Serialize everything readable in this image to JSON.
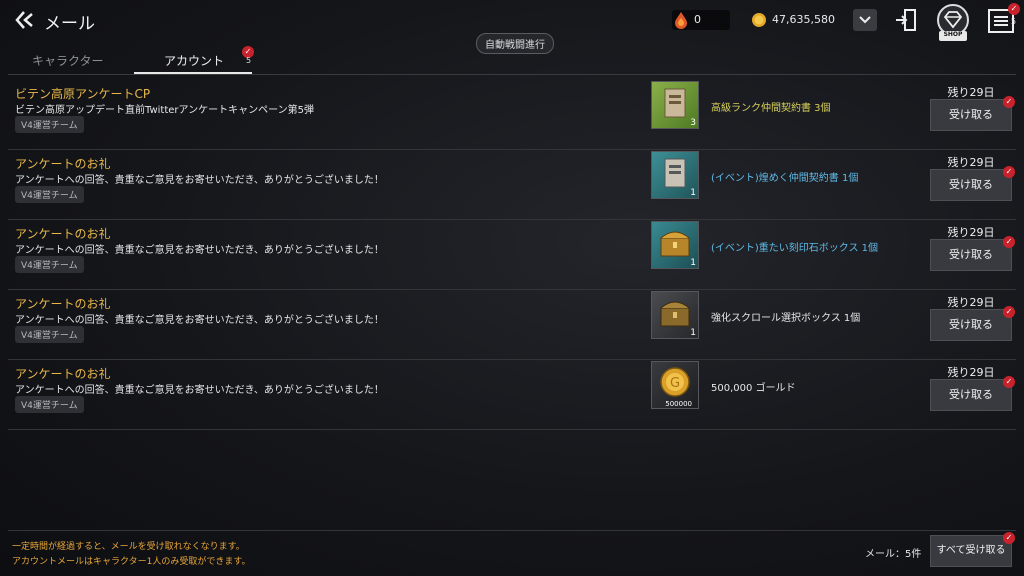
{
  "header": {
    "title": "メール",
    "auto_battle": "自動戦闘進行",
    "ruby_amount": "0",
    "gold_amount": "47,635,580",
    "shop_label": "SHOP",
    "menu_badge": "5"
  },
  "tabs": [
    {
      "label": "キャラクター"
    },
    {
      "label": "アカウント",
      "badge": "5"
    }
  ],
  "mails": [
    {
      "title": "ビテン高原アンケートCP",
      "body": "ビテン高原アップデート直前Twitterアンケートキャンペーン第5弾",
      "sender": "V4運営チーム",
      "item_name": "高級ランク仲間契約書 3個",
      "item_qty": "3",
      "item_color": "#d6cf5a",
      "remaining": "残り29日",
      "button": "受け取る"
    },
    {
      "title": "アンケートのお礼",
      "body": "アンケートへの回答、貴重なご意見をお寄せいただき、ありがとうございました！",
      "sender": "V4運営チーム",
      "item_name": "(イベント)煌めく仲間契約書 1個",
      "item_qty": "1",
      "item_color": "#5fb9e6",
      "remaining": "残り29日",
      "button": "受け取る"
    },
    {
      "title": "アンケートのお礼",
      "body": "アンケートへの回答、貴重なご意見をお寄せいただき、ありがとうございました！",
      "sender": "V4運営チーム",
      "item_name": "(イベント)重たい刻印石ボックス 1個",
      "item_qty": "1",
      "item_color": "#5fb9e6",
      "remaining": "残り29日",
      "button": "受け取る"
    },
    {
      "title": "アンケートのお礼",
      "body": "アンケートへの回答、貴重なご意見をお寄せいただき、ありがとうございました！",
      "sender": "V4運営チーム",
      "item_name": "強化スクロール選択ボックス 1個",
      "item_qty": "1",
      "item_color": "#e6e6e6",
      "remaining": "残り29日",
      "button": "受け取る"
    },
    {
      "title": "アンケートのお礼",
      "body": "アンケートへの回答、貴重なご意見をお寄せいただき、ありがとうございました！",
      "sender": "V4運営チーム",
      "item_name": "500,000 ゴールド",
      "item_qty": "500000",
      "item_color": "#e6e6e6",
      "remaining": "残り29日",
      "button": "受け取る"
    }
  ],
  "footer": {
    "note1": "一定時間が経過すると、メールを受け取れなくなります。",
    "note2": "アカウントメールはキャラクター1人のみ受取ができます。",
    "mail_count": "メール：5件",
    "receive_all": "すべて受け取る"
  },
  "colors": {
    "accent_title": "#e8b84a",
    "badge_red": "#c8232c",
    "footer_note": "#e8a63a"
  }
}
